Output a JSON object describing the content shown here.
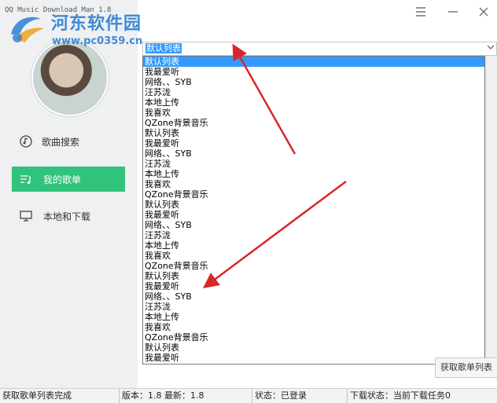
{
  "app": {
    "title": "QQ Music Download Man 1.8"
  },
  "watermark": {
    "text": "河东软件园",
    "url": "www.pc0359.cn"
  },
  "window_controls": {
    "menu_icon": "menu-icon",
    "min_icon": "minimize-icon",
    "close_icon": "close-icon"
  },
  "sidebar": {
    "items": [
      {
        "label": "歌曲搜索",
        "icon": "music-search-icon",
        "active": false
      },
      {
        "label": "我的歌单",
        "icon": "playlist-icon",
        "active": true
      },
      {
        "label": "本地和下载",
        "icon": "monitor-icon",
        "active": false
      }
    ]
  },
  "combo": {
    "value": "默认列表"
  },
  "dropdown": {
    "options": [
      "默认列表",
      "我最爱听",
      "网络、、SYB",
      "汪苏泷",
      "本地上传",
      "我喜欢",
      "QZone背景音乐",
      "默认列表",
      "我最爱听",
      "网络、、SYB",
      "汪苏泷",
      "本地上传",
      "我喜欢",
      "QZone背景音乐",
      "默认列表",
      "我最爱听",
      "网络、、SYB",
      "汪苏泷",
      "本地上传",
      "我喜欢",
      "QZone背景音乐",
      "默认列表",
      "我最爱听",
      "网络、、SYB",
      "汪苏泷",
      "本地上传",
      "我喜欢",
      "QZone背景音乐",
      "默认列表",
      "我最爱听"
    ]
  },
  "fetch_button": {
    "label": "获取歌单列表"
  },
  "statusbar": {
    "message": "获取歌单列表完成",
    "version": "版本：1.8 最新：1.8",
    "login": "状态：已登录",
    "download": "下载状态：当前下载任务0"
  },
  "colors": {
    "accent": "#31c27c",
    "selection": "#3399ff",
    "arrow": "#d9262a"
  }
}
